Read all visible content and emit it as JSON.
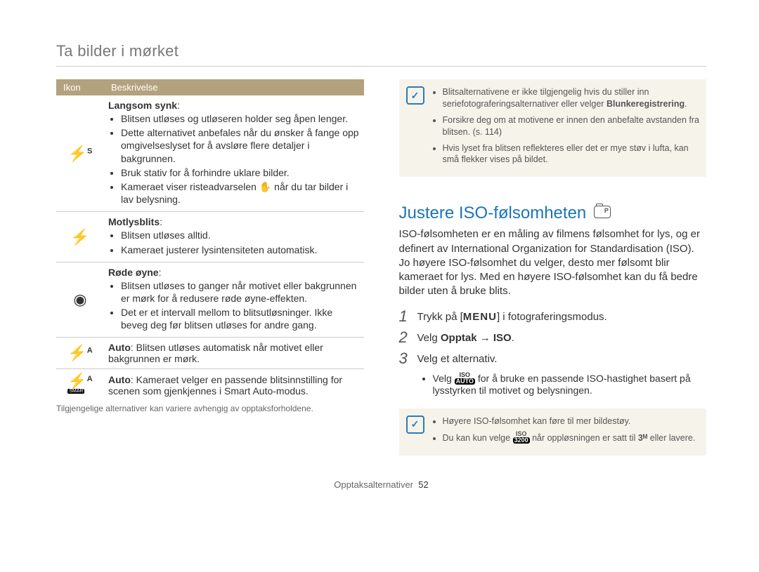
{
  "breadcrumb": "Ta bilder i mørket",
  "table": {
    "headers": {
      "icon": "Ikon",
      "desc": "Beskrivelse"
    },
    "rows": [
      {
        "icon_glyph": "bolt-s",
        "icon_name": "slow-sync-icon",
        "name": "Langsom synk",
        "colon": ":",
        "items": [
          "Blitsen utløses og utløseren holder seg åpen lenger.",
          "Dette alternativet anbefales når du ønsker å fange opp omgivelseslyset for å avsløre flere detaljer i bakgrunnen.",
          "Bruk stativ for å forhindre uklare bilder.",
          "Kameraet viser risteadvarselen ✋ når du tar bilder i lav belysning."
        ]
      },
      {
        "icon_glyph": "bolt-curve",
        "icon_name": "fill-in-icon",
        "name": "Motlysblits",
        "colon": ":",
        "items": [
          "Blitsen utløses alltid.",
          "Kameraet justerer lysintensiteten automatisk."
        ]
      },
      {
        "icon_glyph": "eye",
        "icon_name": "red-eye-icon",
        "name": "Røde øyne",
        "colon": ":",
        "items": [
          "Blitsen utløses to ganger når motivet eller bakgrunnen er mørk for å redusere røde øyne-effekten.",
          "Det er et intervall mellom to blitsutløsninger. Ikke beveg deg før blitsen utløses for andre gang."
        ]
      },
      {
        "icon_glyph": "bolt-a",
        "icon_name": "auto-flash-icon",
        "name": "Auto",
        "inline_text": ": Blitsen utløses automatisk når motivet eller bakgrunnen er mørk."
      },
      {
        "icon_glyph": "bolt-a-smart",
        "icon_name": "smart-auto-flash-icon",
        "name": "Auto",
        "inline_text": ": Kameraet velger en passende blitsinnstilling for scenen som gjenkjennes i Smart Auto-modus."
      }
    ],
    "footnote": "Tilgjengelige alternativer kan variere avhengig av opptaksforholdene."
  },
  "right": {
    "note1": {
      "items": [
        "Blitsalternativene er ikke tilgjengelig hvis du stiller inn seriefotograferingsalternativer eller velger ",
        "Forsikre deg om at motivene er innen den anbefalte avstanden fra blitsen. (s. 114)",
        "Hvis lyset fra blitsen reflekteres eller det er mye støv i lufta, kan små flekker vises på bildet."
      ],
      "blink_label": "Blunkeregistrering"
    },
    "section_title": "Justere ISO-følsomheten",
    "body": "ISO-følsomheten er en måling av filmens følsomhet for lys, og er definert av International Organization for Standardisation (ISO). Jo høyere ISO-følsomhet du velger, desto mer følsomt blir kameraet for lys. Med en høyere ISO-følsomhet kan du få bedre bilder uten å bruke blits.",
    "steps": [
      {
        "num": "1",
        "pre": "Trykk på [",
        "menu": "MENU",
        "post": "] i fotograferingsmodus."
      },
      {
        "num": "2",
        "text_pre": "Velg ",
        "bold": "Opptak → ISO",
        "text_post": "."
      },
      {
        "num": "3",
        "text": "Velg et alternativ."
      }
    ],
    "step3_bullet_pre": "Velg ",
    "iso_badge_top": "ISO",
    "iso_badge_bot": "AUTO",
    "step3_bullet_post": " for å bruke en passende ISO-hastighet basert på lysstyrken til motivet og belysningen.",
    "note2": {
      "items": [
        "Høyere ISO-følsomhet kan føre til mer bildestøy.",
        "Du kan kun velge "
      ],
      "iso_badge_top": "ISO",
      "iso_badge_bot": "3200",
      "item2_mid": " når oppløsningen er satt til ",
      "three_m": "3ᴹ",
      "item2_post": " eller lavere."
    }
  },
  "footer": {
    "section": "Opptaksalternativer",
    "page": "52"
  }
}
